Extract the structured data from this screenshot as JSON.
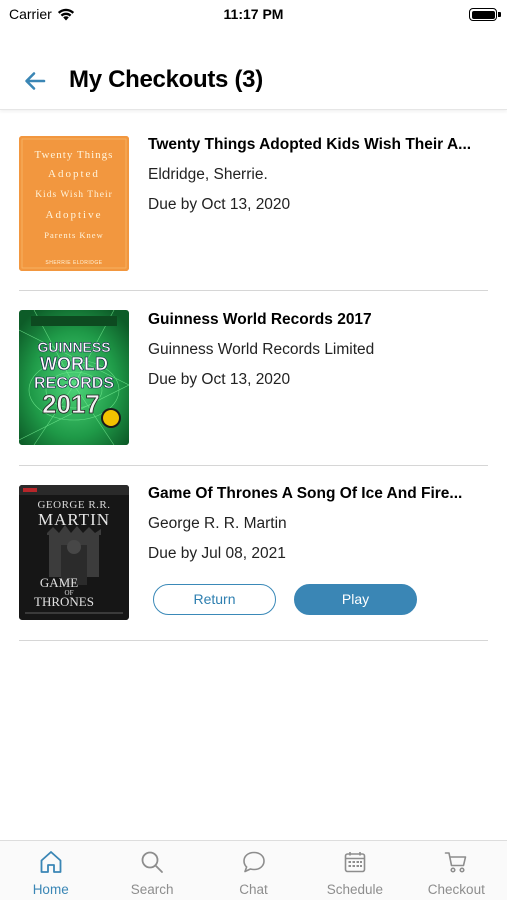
{
  "status_bar": {
    "carrier": "Carrier",
    "time": "11:17 PM"
  },
  "header": {
    "title": "My Checkouts (3)"
  },
  "checkouts": [
    {
      "title": "Twenty Things Adopted Kids Wish Their A...",
      "author": "Eldridge, Sherrie.",
      "due": "Due by Oct 13, 2020",
      "cover_lines": [
        "Twenty Things",
        "Adopted",
        "Kids Wish Their",
        "Adoptive",
        "Parents Knew"
      ],
      "cover_author": "SHERRIE ELDRIDGE"
    },
    {
      "title": "Guinness World Records 2017",
      "author": "Guinness World Records Limited",
      "due": "Due by Oct 13, 2020",
      "cover_lines": [
        "GUINNESS",
        "WORLD",
        "RECORDS",
        "2017"
      ]
    },
    {
      "title": "Game Of Thrones A Song Of Ice And Fire...",
      "author": "George R. R. Martin",
      "due": "Due by Jul 08, 2021",
      "cover_lines": [
        "GEORGE R.R.",
        "MARTIN",
        "GAME",
        "OF",
        "THRONES"
      ],
      "actions": {
        "return_label": "Return",
        "play_label": "Play"
      }
    }
  ],
  "tab_bar": {
    "tabs": [
      {
        "label": "Home",
        "icon": "home-icon",
        "active": true
      },
      {
        "label": "Search",
        "icon": "search-icon",
        "active": false
      },
      {
        "label": "Chat",
        "icon": "chat-icon",
        "active": false
      },
      {
        "label": "Schedule",
        "icon": "calendar-icon",
        "active": false
      },
      {
        "label": "Checkout",
        "icon": "cart-icon",
        "active": false
      }
    ]
  },
  "colors": {
    "accent": "#3a86b5",
    "inactive": "#8d8d8d",
    "divider": "#d6d6d6"
  }
}
